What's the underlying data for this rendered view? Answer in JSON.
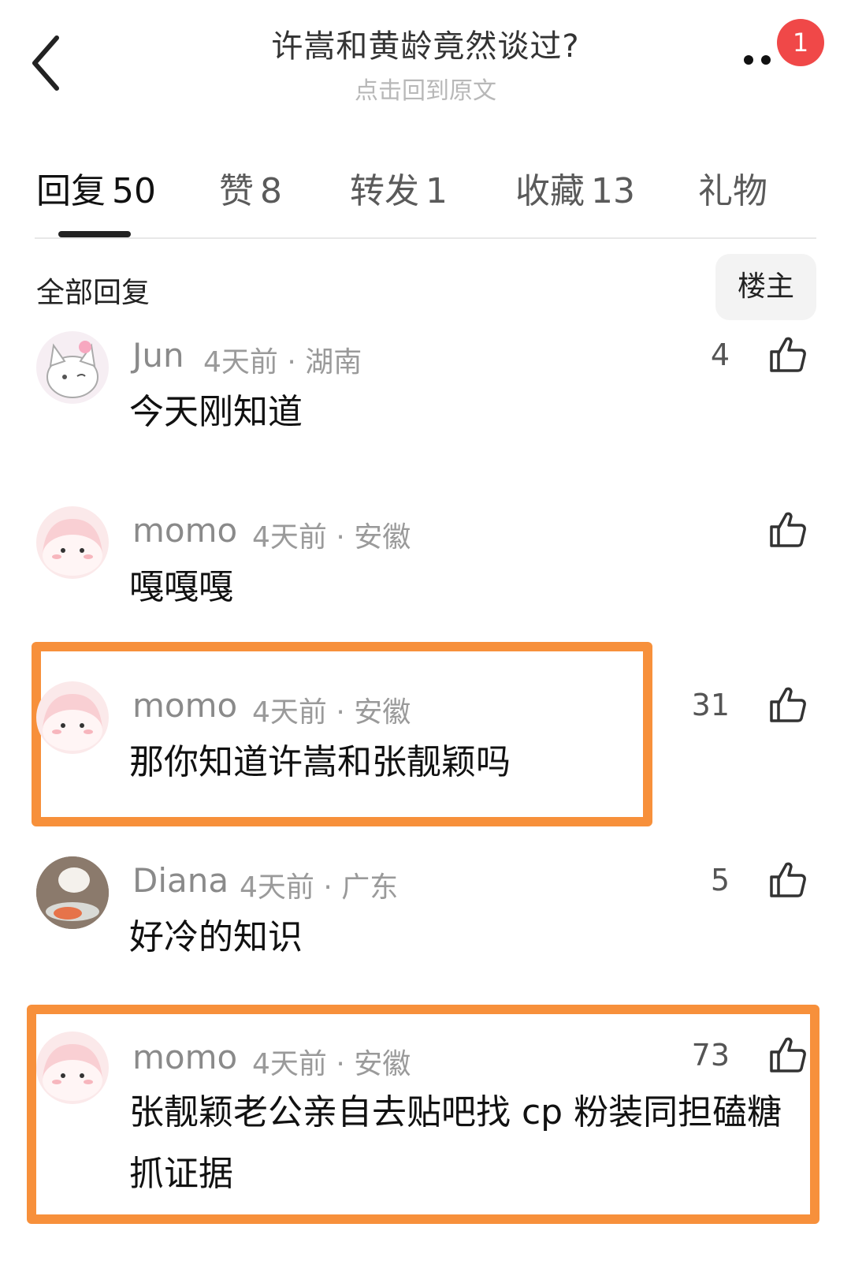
{
  "header": {
    "title": "许嵩和黄龄竟然谈过?",
    "subtitle": "点击回到原文",
    "notification_count": "1",
    "icons": [
      "chevron-left-icon",
      "more-icon"
    ]
  },
  "tabs": [
    {
      "label": "回复",
      "count": "50",
      "active": true
    },
    {
      "label": "赞",
      "count": "8"
    },
    {
      "label": "转发",
      "count": "1"
    },
    {
      "label": "收藏",
      "count": "13"
    },
    {
      "label": "礼物",
      "count": ""
    }
  ],
  "section": {
    "title": "全部回复",
    "op_filter": "楼主"
  },
  "comments": [
    {
      "user": "Jun",
      "time": "4天前",
      "location": "湖南",
      "text": "今天刚知道",
      "likes": "4"
    },
    {
      "user": "momo",
      "time": "4天前",
      "location": "安徽",
      "text": "嘎嘎嘎",
      "likes": ""
    },
    {
      "user": "momo",
      "time": "4天前",
      "location": "安徽",
      "text": "那你知道许嵩和张靓颖吗",
      "likes": "31",
      "highlighted": true
    },
    {
      "user": "Diana",
      "time": "4天前",
      "location": "广东",
      "text": "好冷的知识",
      "likes": "5"
    },
    {
      "user": "momo",
      "time": "4天前",
      "location": "安徽",
      "text": "张靓颖老公亲自去贴吧找 cp 粉装同担磕糖抓证据",
      "likes": "73",
      "highlighted": true
    }
  ],
  "colors": {
    "highlight": "#f7903b",
    "badge": "#f04848",
    "text_primary": "#111111",
    "text_secondary": "#9a9a9a"
  }
}
